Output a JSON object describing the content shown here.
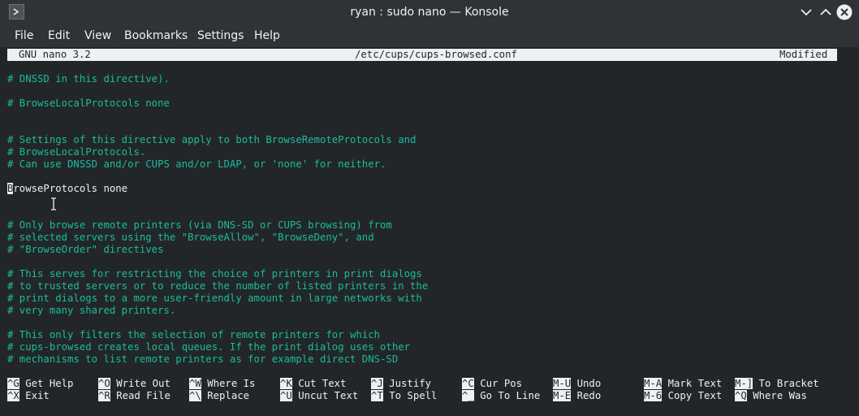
{
  "window": {
    "title": "ryan : sudo nano — Konsole"
  },
  "menubar": {
    "items": [
      "File",
      "Edit",
      "View",
      "Bookmarks",
      "Settings",
      "Help"
    ]
  },
  "nano": {
    "version": "GNU nano 3.2",
    "filename": "/etc/cups/cups-browsed.conf",
    "status": "Modified"
  },
  "editor": {
    "lines": [
      {
        "type": "comment",
        "text": "# DNSSD in this directive)."
      },
      {
        "type": "blank",
        "text": ""
      },
      {
        "type": "comment",
        "text": "# BrowseLocalProtocols none"
      },
      {
        "type": "blank",
        "text": ""
      },
      {
        "type": "blank",
        "text": ""
      },
      {
        "type": "comment",
        "text": "# Settings of this directive apply to both BrowseRemoteProtocols and"
      },
      {
        "type": "comment",
        "text": "# BrowseLocalProtocols."
      },
      {
        "type": "comment",
        "text": "# Can use DNSSD and/or CUPS and/or LDAP, or 'none' for neither."
      },
      {
        "type": "blank",
        "text": ""
      },
      {
        "type": "code",
        "cursor_char": "B",
        "text": "rowseProtocols none"
      },
      {
        "type": "blank",
        "text": ""
      },
      {
        "type": "blank",
        "text": ""
      },
      {
        "type": "comment",
        "text": "# Only browse remote printers (via DNS-SD or CUPS browsing) from"
      },
      {
        "type": "comment",
        "text": "# selected servers using the \"BrowseAllow\", \"BrowseDeny\", and"
      },
      {
        "type": "comment",
        "text": "# \"BrowseOrder\" directives"
      },
      {
        "type": "blank",
        "text": ""
      },
      {
        "type": "comment",
        "text": "# This serves for restricting the choice of printers in print dialogs"
      },
      {
        "type": "comment",
        "text": "# to trusted servers or to reduce the number of listed printers in the"
      },
      {
        "type": "comment",
        "text": "# print dialogs to a more user-friendly amount in large networks with"
      },
      {
        "type": "comment",
        "text": "# very many shared printers."
      },
      {
        "type": "blank",
        "text": ""
      },
      {
        "type": "comment",
        "text": "# This only filters the selection of remote printers for which"
      },
      {
        "type": "comment",
        "text": "# cups-browsed creates local queues. If the print dialog uses other"
      },
      {
        "type": "comment",
        "text": "# mechanisms to list remote printers as for example direct DNS-SD"
      }
    ]
  },
  "shortcuts": {
    "row1": [
      {
        "key": "^G",
        "label": "Get Help"
      },
      {
        "key": "^O",
        "label": "Write Out"
      },
      {
        "key": "^W",
        "label": "Where Is"
      },
      {
        "key": "^K",
        "label": "Cut Text"
      },
      {
        "key": "^J",
        "label": "Justify"
      },
      {
        "key": "^C",
        "label": "Cur Pos"
      },
      {
        "key": "M-U",
        "label": "Undo"
      },
      {
        "key": "M-A",
        "label": "Mark Text"
      },
      {
        "key": "M-]",
        "label": "To Bracket"
      }
    ],
    "row2": [
      {
        "key": "^X",
        "label": "Exit"
      },
      {
        "key": "^R",
        "label": "Read File"
      },
      {
        "key": "^\\",
        "label": "Replace"
      },
      {
        "key": "^U",
        "label": "Uncut Text"
      },
      {
        "key": "^T",
        "label": "To Spell"
      },
      {
        "key": "^_",
        "label": "Go To Line"
      },
      {
        "key": "M-E",
        "label": "Redo"
      },
      {
        "key": "M-6",
        "label": "Copy Text"
      },
      {
        "key": "^Q",
        "label": "Where Was"
      }
    ]
  }
}
